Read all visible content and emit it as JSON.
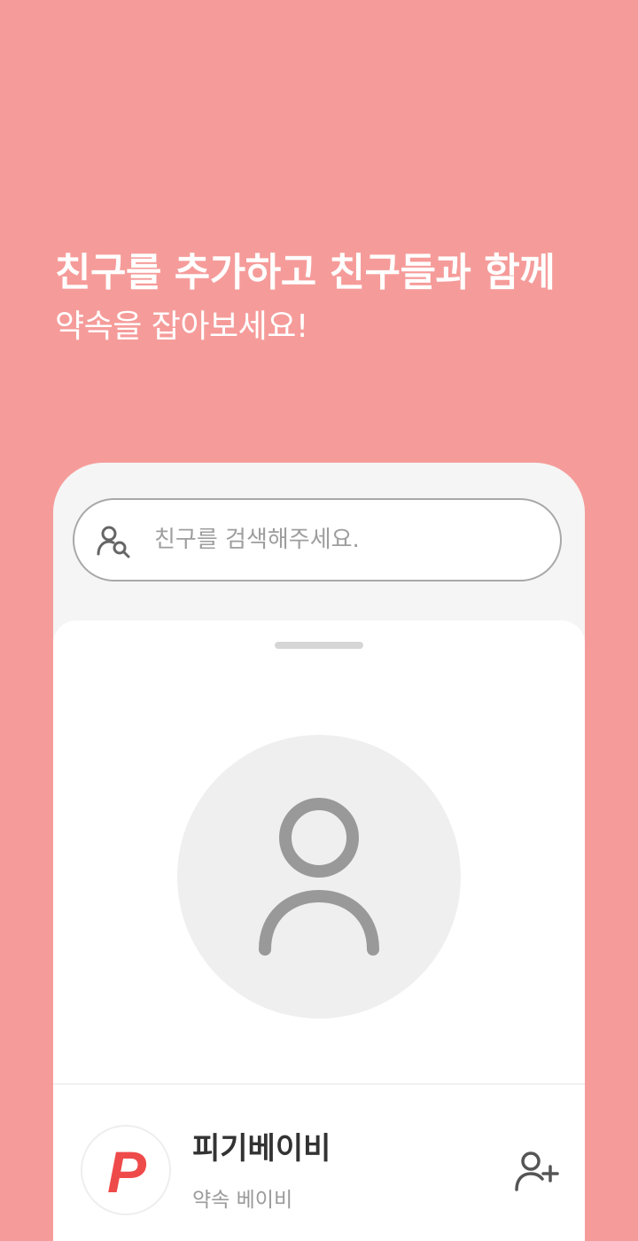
{
  "colors": {
    "background": "#f59c9a",
    "card_background": "#f5f5f5",
    "sheet_background": "#ffffff",
    "placeholder_text": "#9e9e9e",
    "icon_gray": "#999999",
    "brand_red": "#ef4a4a"
  },
  "headline": {
    "line1": "친구를 추가하고 친구들과 함께",
    "line2": "약속을 잡아보세요!"
  },
  "search": {
    "icon": "user-search-icon",
    "placeholder": "친구를 검색해주세요."
  },
  "profile": {
    "icon": "user-silhouette-icon"
  },
  "app_item": {
    "logo_letter": "P",
    "name": "피기베이비",
    "subtitle": "약속 베이비",
    "action_icon": "add-user-icon"
  }
}
